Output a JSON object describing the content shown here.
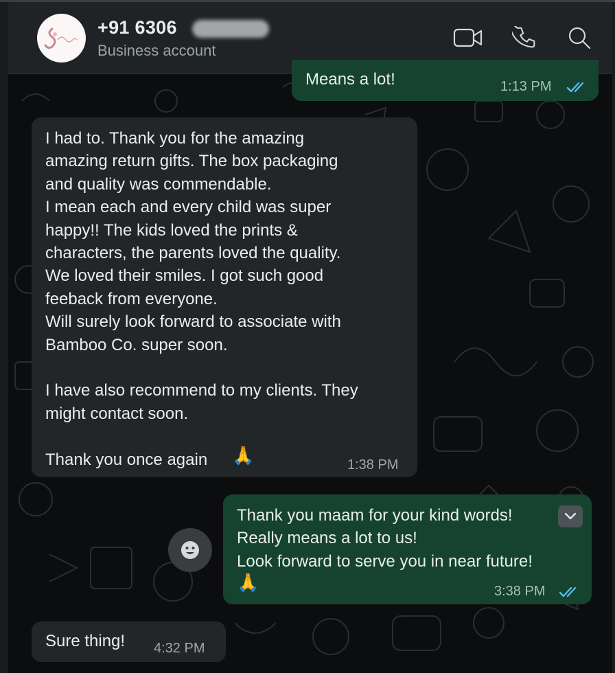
{
  "header": {
    "contact_name": "+91 6306",
    "subtitle": "Business account",
    "avatar_name": "company-logo"
  },
  "messages": [
    {
      "direction": "out",
      "text": "Means a lot!",
      "time": "1:13 PM",
      "status": "read"
    },
    {
      "direction": "in",
      "text": "I had to. Thank you for the amazing\namazing return gifts. The box packaging\nand quality was commendable.\nI mean each and every child was super\nhappy!! The kids loved the prints &\ncharacters, the parents loved the quality.\nWe loved their smiles. I got such good\nfeeback from everyone.\nWill surely look forward to associate with\nBamboo Co. super soon.\n\nI have also recommend to my clients. They\nmight contact soon.\n\nThank you once again",
      "emoji": "🙏",
      "time": "1:38 PM"
    },
    {
      "direction": "out",
      "text": "Thank you maam for your kind words!\nReally means a lot to us!\nLook forward to serve you in near future!",
      "emoji": "🙏",
      "time": "3:38 PM",
      "status": "read"
    },
    {
      "direction": "in",
      "text": "Sure thing!",
      "time": "4:32 PM"
    }
  ],
  "icons": {
    "video": "video-call-icon",
    "phone": "voice-call-icon",
    "search": "search-icon",
    "react": "emoji-reaction-icon",
    "menu": "chevron-down-icon",
    "ticks": "double-check-icon"
  },
  "colors": {
    "header_bg": "#1f2326",
    "incoming_bubble": "#232627",
    "outgoing_bubble": "#15432f",
    "read_ticks": "#53bdeb"
  }
}
